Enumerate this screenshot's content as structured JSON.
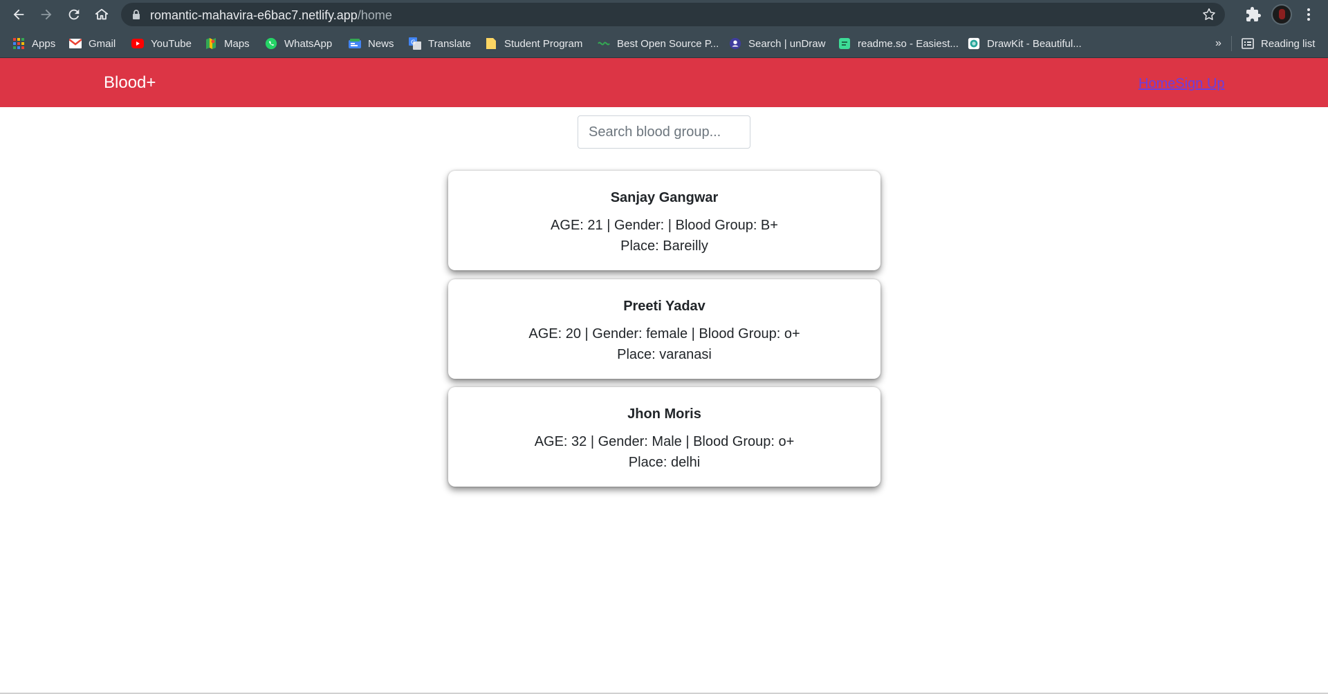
{
  "browser": {
    "url_host": "romantic-mahavira-e6bac7.netlify.app",
    "url_path": "/home",
    "bookmarks": [
      {
        "label": "Apps",
        "icon": "apps-grid-icon"
      },
      {
        "label": "Gmail",
        "icon": "gmail-icon"
      },
      {
        "label": "YouTube",
        "icon": "youtube-icon"
      },
      {
        "label": "Maps",
        "icon": "maps-icon"
      },
      {
        "label": "WhatsApp",
        "icon": "whatsapp-icon"
      },
      {
        "label": "News",
        "icon": "news-icon"
      },
      {
        "label": "Translate",
        "icon": "translate-icon"
      },
      {
        "label": "Student Program",
        "icon": "folder-icon"
      },
      {
        "label": "Best Open Source P...",
        "icon": "opensource-icon"
      },
      {
        "label": "Search | unDraw",
        "icon": "undraw-icon"
      },
      {
        "label": "readme.so - Easiest...",
        "icon": "readme-icon"
      },
      {
        "label": "DrawKit - Beautiful...",
        "icon": "drawkit-icon"
      }
    ],
    "overflow_label": "»",
    "reading_list": "Reading list"
  },
  "navbar": {
    "brand": "Blood+",
    "links": [
      "Home",
      "Sign Up"
    ],
    "color": "#dc3545"
  },
  "search": {
    "placeholder": "Search blood group..."
  },
  "donors": [
    {
      "name": "Sanjay Gangwar",
      "details": "AGE: 21 | Gender: | Blood Group: B+",
      "place": "Place: Bareilly"
    },
    {
      "name": "Preeti Yadav",
      "details": "AGE: 20 | Gender: female | Blood Group: o+",
      "place": "Place: varanasi"
    },
    {
      "name": "Jhon Moris",
      "details": "AGE: 32 | Gender: Male | Blood Group: o+",
      "place": "Place: delhi"
    }
  ]
}
